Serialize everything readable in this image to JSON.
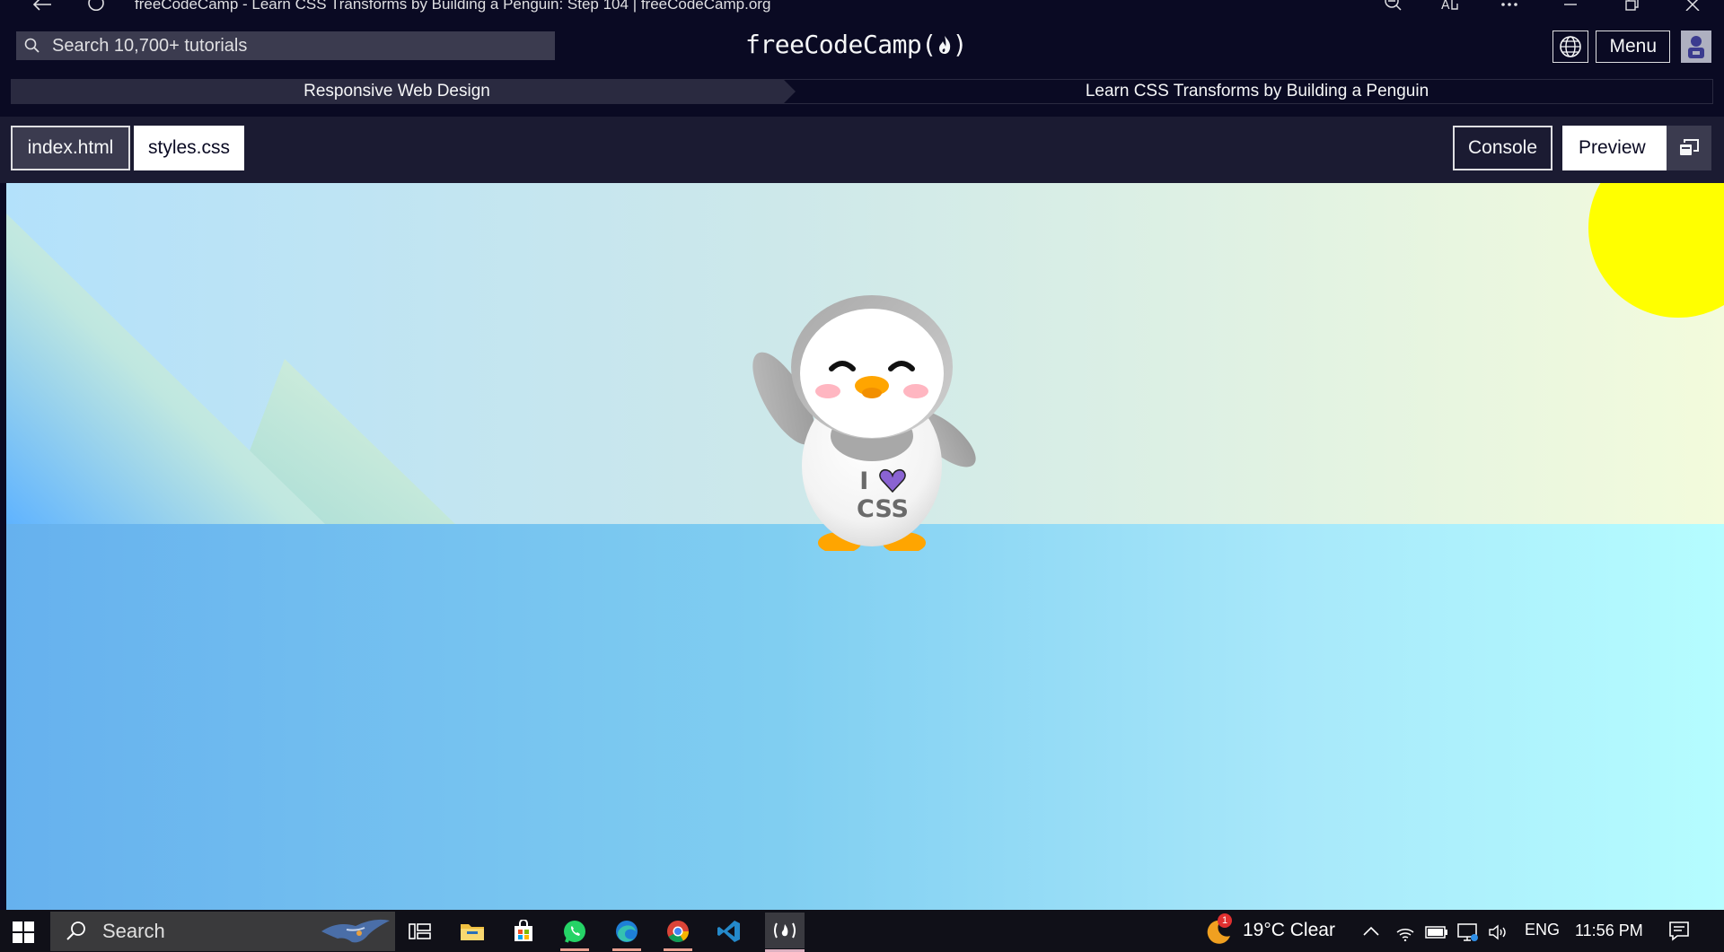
{
  "window": {
    "title": "freeCodeCamp - Learn CSS Transforms by Building a Penguin: Step 104 | freeCodeCamp.org"
  },
  "navbar": {
    "search_placeholder": "Search 10,700+ tutorials",
    "logo_text": "freeCodeCamp",
    "menu_label": "Menu"
  },
  "breadcrumb": {
    "superblock": "Responsive Web Design",
    "block": "Learn CSS Transforms by Building a Penguin"
  },
  "editor_tabs": {
    "files": [
      "index.html",
      "styles.css"
    ],
    "console_label": "Console",
    "preview_label": "Preview"
  },
  "preview": {
    "shirt_line1": "I",
    "shirt_line2": "CSS",
    "icons": [
      "sun",
      "mountain",
      "penguin",
      "heart"
    ]
  },
  "taskbar": {
    "search_label": "Search",
    "weather": "19°C  Clear",
    "weather_badge": "1",
    "language": "ENG",
    "time": "11:56 PM",
    "apps": [
      "task-view",
      "file-explorer",
      "store",
      "whatsapp",
      "edge",
      "chrome",
      "vscode",
      "freecodecamp"
    ]
  },
  "colors": {
    "nav_bg": "#0a0a23",
    "toolbar_bg": "#1b1b32",
    "sun": "#ffff00",
    "heart": "#8a63d2",
    "beak": "#ffa500"
  }
}
